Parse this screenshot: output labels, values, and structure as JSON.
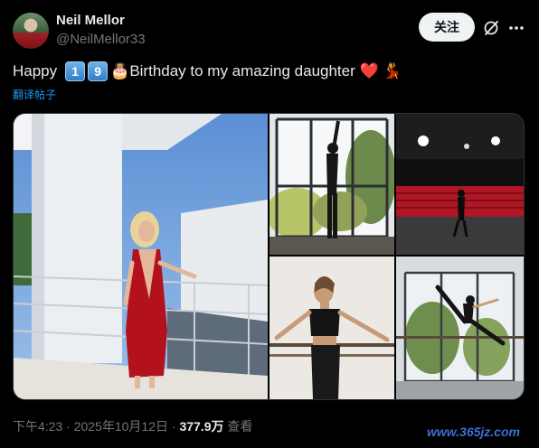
{
  "user": {
    "name": "Neil Mellor",
    "handle": "@NeilMellor33"
  },
  "actions": {
    "follow_label": "关注",
    "grok_icon": "grok-icon",
    "more_icon": "more-icon"
  },
  "tweet": {
    "text_before": "Happy",
    "keycap_1": "1",
    "keycap_2": "9",
    "cake_emoji": "🎂",
    "text_after": "Birthday to my amazing daughter",
    "heart_emoji": "❤️",
    "dancer_emoji": "💃",
    "translate_label": "翻译帖子"
  },
  "media": {
    "photos": [
      {
        "alt": "woman in red gown on balcony"
      },
      {
        "alt": "dancer silhouette by window"
      },
      {
        "alt": "dancer on stage with red seats"
      },
      {
        "alt": "dancer at ballet barre"
      },
      {
        "alt": "dancer leaping by window"
      }
    ]
  },
  "footer": {
    "time": "下午4:23",
    "separator": " · ",
    "date": "2025年10月12日",
    "views_count": "377.9万",
    "views_label": " 查看"
  },
  "watermark": "www.365jz.com",
  "colors": {
    "accent": "#1d9bf0",
    "background": "#000000",
    "muted": "#71767b"
  }
}
